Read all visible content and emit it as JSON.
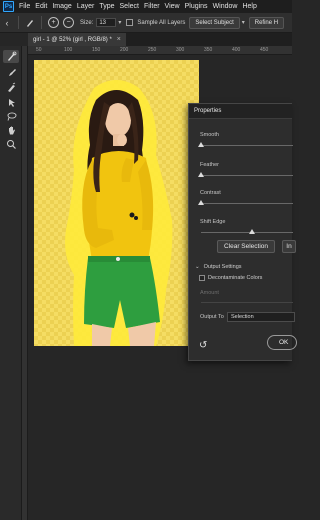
{
  "app": {
    "logo": "Ps"
  },
  "menu": [
    "File",
    "Edit",
    "Image",
    "Layer",
    "Type",
    "Select",
    "Filter",
    "View",
    "Plugins",
    "Window",
    "Help"
  ],
  "options": {
    "size_label": "Size:",
    "size_value": "13",
    "sample_all_layers": "Sample All Layers",
    "select_subject": "Select Subject",
    "refine_hair": "Refine H"
  },
  "tab": {
    "title": "girl - 1 @ 52% (girl , RGB/8) *"
  },
  "ruler": {
    "labels": [
      "50",
      "100",
      "150",
      "200",
      "250",
      "300",
      "350",
      "400",
      "450"
    ]
  },
  "properties": {
    "title": "Properties",
    "smooth_label": "Smooth",
    "feather_label": "Feather",
    "contrast_label": "Contrast",
    "shift_edge_label": "Shift Edge",
    "smooth_value": 0,
    "feather_value": 0,
    "contrast_value": 0,
    "shift_edge_value": 0.55,
    "clear_selection": "Clear Selection",
    "invert_label": "In",
    "output_settings": "Output Settings",
    "decontaminate": "Decontaminate Colors",
    "amount_label": "Amount",
    "output_to_label": "Output To",
    "output_to_value": "Selection",
    "ok_label": "OK"
  },
  "icons": {
    "menu_logo": "ps-logo-icon",
    "back": "chevron-left-icon",
    "brush": "brush-icon",
    "reset": "reset-icon"
  },
  "colors": {
    "background": "#262626",
    "canvas_yellow": "#f5dd63",
    "sweater": "#f1c40f",
    "shorts": "#2e9e3f",
    "panel": "#2d2d2d"
  }
}
